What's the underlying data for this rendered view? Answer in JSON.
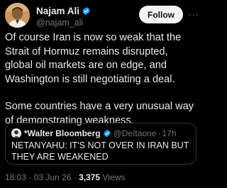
{
  "author": {
    "display_name": "Najam Ali",
    "handle": "@najam_ali",
    "verified_badge_color": "#1d9bf0"
  },
  "actions": {
    "follow_label": "Follow",
    "more_label": "···"
  },
  "tweet": {
    "paragraph1_lines": [
      "Of course Iran is now so weak that the",
      "Strait of Hormuz remains disrupted,",
      "global oil markets are on edge, and",
      "Washington is still negotiating a deal."
    ],
    "paragraph2_lines": [
      "Some countries have a very unusual way",
      "of demonstrating weakness."
    ]
  },
  "quote": {
    "display_name": "*Walter Bloomberg",
    "handle": "@DeItaone",
    "separator": "·",
    "time": "17h",
    "badge_color": "#1d9bf0",
    "text_lines": [
      "NETANYAHU: IT'S NOT OVER IN IRAN BUT",
      "THEY ARE WEAKENED"
    ]
  },
  "meta": {
    "timestamp": "18:03 · 03 Jun 26 ·",
    "views_count": "3,375",
    "views_label": "Views"
  }
}
